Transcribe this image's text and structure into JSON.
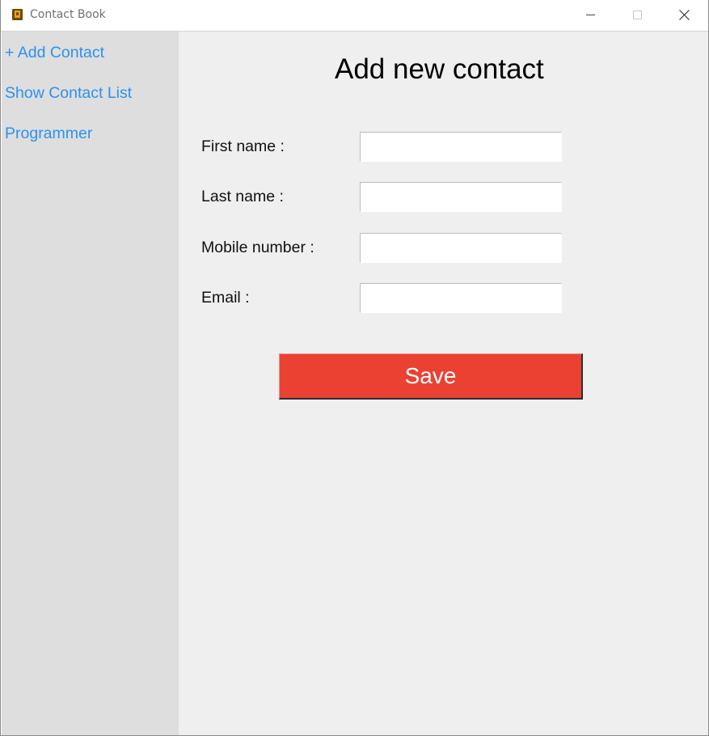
{
  "window": {
    "title": "Contact Book",
    "icon": "contact-book-icon",
    "controls": [
      "minimize-icon",
      "maximize-icon",
      "close-icon"
    ]
  },
  "sidebar": {
    "items": [
      {
        "label": "+ Add Contact"
      },
      {
        "label": "Show Contact List"
      },
      {
        "label": "Programmer"
      }
    ],
    "link_color": "#2b91f0",
    "background": "#dedede"
  },
  "form": {
    "title": "Add new contact",
    "fields": [
      {
        "label": "First name :",
        "value": ""
      },
      {
        "label": "Last name :",
        "value": ""
      },
      {
        "label": "Mobile number :",
        "value": ""
      },
      {
        "label": "Email :",
        "value": ""
      }
    ],
    "save_label": "Save",
    "save_color": "#ea4133",
    "background": "#efefef"
  }
}
